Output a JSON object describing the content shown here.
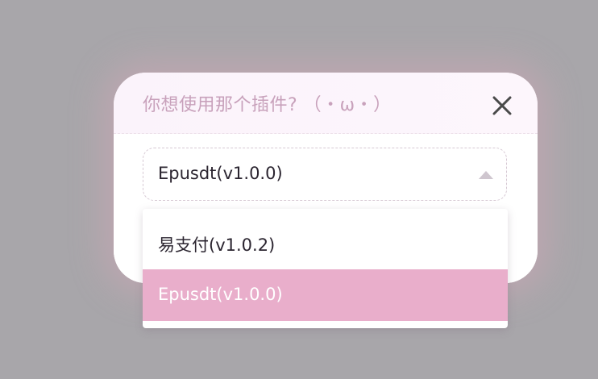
{
  "dialog": {
    "title": "你想使用那个插件? （・ω・）",
    "close_icon": "close-icon"
  },
  "select": {
    "selected_value": "Epusdt(v1.0.0)",
    "arrow_icon": "caret-up-icon",
    "expanded": true
  },
  "dropdown": {
    "options": [
      {
        "label": "易支付(v1.0.2)",
        "selected": false
      },
      {
        "label": "Epusdt(v1.0.0)",
        "selected": true
      }
    ]
  },
  "colors": {
    "title_color": "#c8a1bb",
    "selected_option_bg": "#e9aecb",
    "backdrop": "#a8a6aa"
  }
}
